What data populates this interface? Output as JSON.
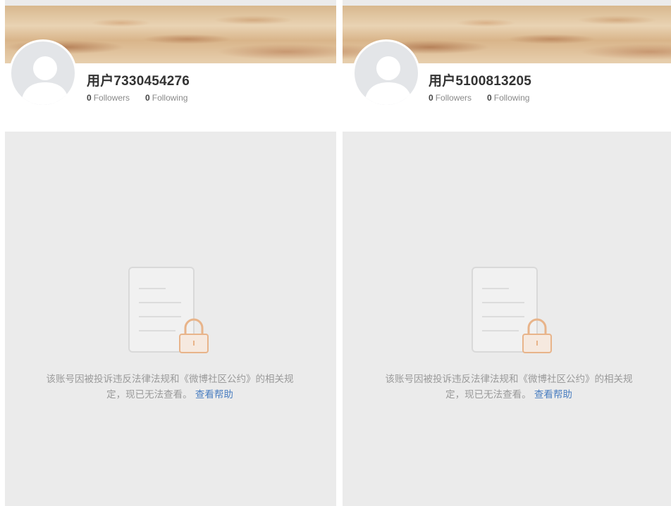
{
  "profiles": [
    {
      "username": "用户7330454276",
      "followers_count": "0",
      "followers_label": "Followers",
      "following_count": "0",
      "following_label": "Following",
      "notice_text": "该账号因被投诉违反法律法规和《微博社区公约》的相关规定，现已无法查看。",
      "help_link": "查看帮助"
    },
    {
      "username": "用户5100813205",
      "followers_count": "0",
      "followers_label": "Followers",
      "following_count": "0",
      "following_label": "Following",
      "notice_text": "该账号因被投诉违反法律法规和《微博社区公约》的相关规定，现已无法查看。",
      "help_link": "查看帮助"
    }
  ],
  "icons": {
    "avatar": "default-avatar-icon",
    "locked_document": "locked-document-icon"
  },
  "colors": {
    "background": "#ebebeb",
    "link": "#4a7ec0",
    "lock": "#e8b48a"
  }
}
